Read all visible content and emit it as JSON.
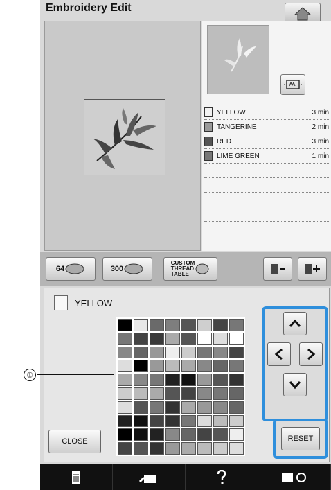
{
  "header": {
    "title": "Embroidery Edit"
  },
  "thread_list": [
    {
      "name": "YELLOW",
      "time": "3 min",
      "color": "#f2f2f2"
    },
    {
      "name": "TANGERINE",
      "time": "2 min",
      "color": "#9a9a9a"
    },
    {
      "name": "RED",
      "time": "3 min",
      "color": "#555555"
    },
    {
      "name": "LIME GREEN",
      "time": "1 min",
      "color": "#777777"
    }
  ],
  "toolbar": {
    "btn_64": "64",
    "btn_300": "300",
    "custom_label": "CUSTOM\nTHREAD\nTABLE"
  },
  "editor": {
    "selected_thread": "YELLOW",
    "close_label": "CLOSE",
    "reset_label": "RESET"
  },
  "callout": {
    "number": "①"
  },
  "palette": [
    "#000",
    "#e8e8e8",
    "#6a6a6a",
    "#7e7e7e",
    "#555",
    "#cfcfcf",
    "#444",
    "#777",
    "#777",
    "#444",
    "#3a3a3a",
    "#aaa",
    "#555",
    "#fff",
    "#ddd",
    "#fff",
    "#888",
    "#666",
    "#999",
    "#eee",
    "#ccc",
    "#777",
    "#888",
    "#444",
    "#ddd",
    "#000",
    "#999",
    "#bbb",
    "#aaa",
    "#888",
    "#666",
    "#777",
    "#aaa",
    "#888",
    "#777",
    "#222",
    "#111",
    "#999",
    "#555",
    "#333",
    "#ccc",
    "#bbb",
    "#aaa",
    "#555",
    "#444",
    "#888",
    "#777",
    "#666",
    "#ddd",
    "#555",
    "#777",
    "#333",
    "#aaa",
    "#999",
    "#888",
    "#666",
    "#222",
    "#111",
    "#444",
    "#333",
    "#777",
    "#dcdcdc",
    "#bcbcbc",
    "#ccc",
    "#000",
    "#111",
    "#222",
    "#888",
    "#666",
    "#444",
    "#555",
    "#eee",
    "#444",
    "#555",
    "#333",
    "#999",
    "#aaa",
    "#bbb",
    "#ccc",
    "#ddd"
  ]
}
